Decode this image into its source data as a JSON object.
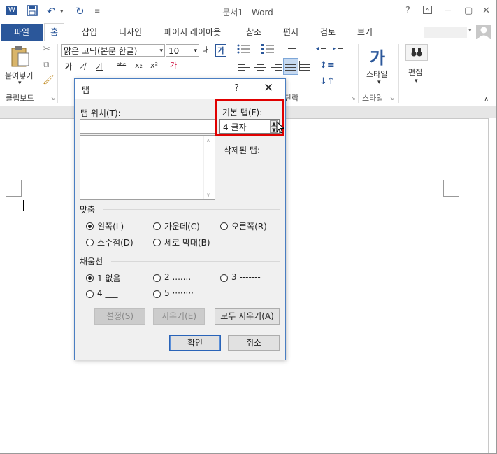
{
  "window": {
    "title": "문서1 - Word",
    "help": "?",
    "minimize": "─",
    "restore": "▢",
    "close": "✕"
  },
  "quick_access": {
    "word_logo": "W",
    "save": "💾",
    "undo": "↶",
    "undo_drop": "▾",
    "redo": "↻",
    "customize": "≡"
  },
  "tabs": {
    "file": "파일",
    "items": [
      "홈",
      "삽입",
      "디자인",
      "페이지 레이아웃",
      "참조",
      "편지",
      "검토",
      "보기"
    ]
  },
  "ribbon": {
    "clipboard": {
      "paste": "붙여넣기",
      "group": "클립보드"
    },
    "font": {
      "name": "맑은 고딕(본문 한글)",
      "size": "10",
      "bold": "가",
      "italic": "가",
      "underline": "가",
      "strike": "ᵃᵇᶜ",
      "sub": "x₂",
      "sup": "x²",
      "grow": "내",
      "clear": "가"
    },
    "paragraph": {
      "group": "단락"
    },
    "styles": {
      "label": "스타일",
      "group": "스타일",
      "icon": "가"
    },
    "editing": {
      "label": "편집"
    }
  },
  "dialog": {
    "title": "탭",
    "help": "?",
    "close": "✕",
    "tab_position_label": "탭 위치(T):",
    "tab_position_value": "",
    "default_tab_label": "기본 탭(F):",
    "default_tab_value": "4 글자",
    "cleared_tabs_label": "삭제된 탭:",
    "alignment": {
      "title": "맞춤",
      "options": [
        "왼쪽(L)",
        "가운데(C)",
        "오른쪽(R)",
        "소수점(D)",
        "세로 막대(B)"
      ],
      "selected": "왼쪽(L)"
    },
    "leader": {
      "title": "채움선",
      "options": [
        "1 없음",
        "2 .......",
        "3 -------",
        "4 ___",
        "5 ········"
      ],
      "selected": "1 없음"
    },
    "buttons": {
      "set": "설정(S)",
      "clear": "지우기(E)",
      "clear_all": "모두 지우기(A)",
      "ok": "확인",
      "cancel": "취소"
    }
  }
}
